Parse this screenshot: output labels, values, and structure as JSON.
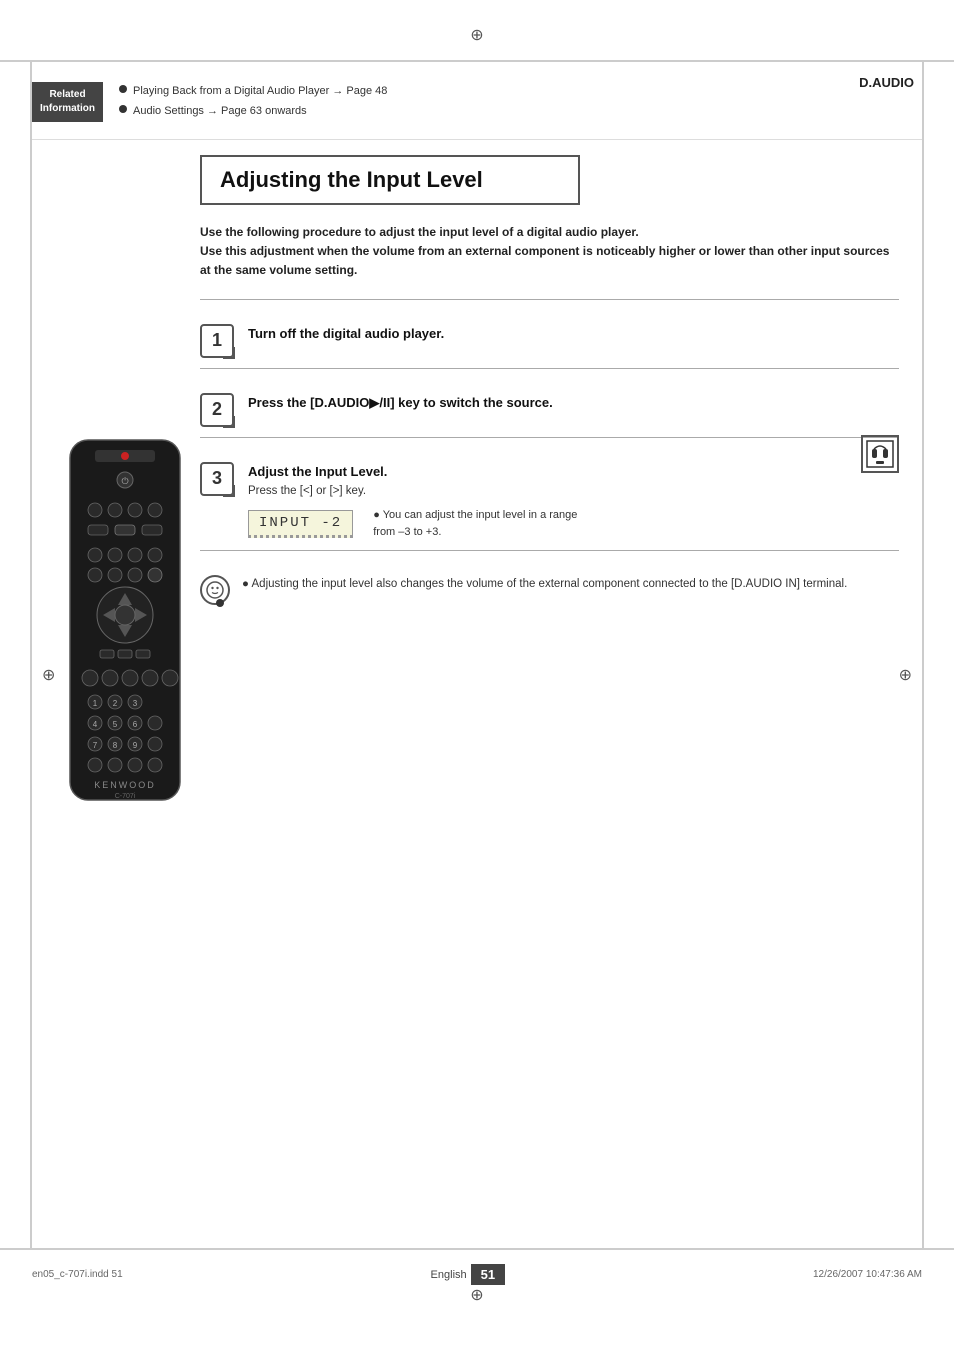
{
  "page": {
    "title": "Adjusting the Input Level",
    "section": "D.AUDIO",
    "language": "English",
    "page_number": "51",
    "filename": "en05_c-707i.indd  51",
    "datetime": "12/26/2007  10:47:36 AM"
  },
  "header": {
    "related_label_line1": "Related",
    "related_label_line2": "Information",
    "link1": "Playing Back from a Digital Audio Player → Page 48",
    "link2": "Audio Settings → Page 63 onwards"
  },
  "intro": {
    "line1": "Use the following procedure to adjust the input level of a digital audio player.",
    "line2": "Use this adjustment when the volume from an external component is noticeably higher or lower than other input sources at the same volume setting."
  },
  "steps": [
    {
      "number": "1",
      "title": "Turn off the digital audio player.",
      "subtext": ""
    },
    {
      "number": "2",
      "title": "Press the [D.AUDIO▶/II] key to switch the source.",
      "subtext": ""
    },
    {
      "number": "3",
      "title": "Adjust the Input Level.",
      "subtext": "Press the [<] or [>] key.",
      "lcd_text": "INPUT    -2",
      "lcd_note_line1": "● You can adjust the input level in a range",
      "lcd_note_line2": "from –3 to +3."
    }
  ],
  "note": {
    "text": "● Adjusting the input level also changes the volume of the external component connected to the [D.AUDIO IN] terminal."
  },
  "icons": {
    "crosshair": "⊕",
    "bullet": "●",
    "headphone": "🎧",
    "note_symbol": "♪"
  }
}
